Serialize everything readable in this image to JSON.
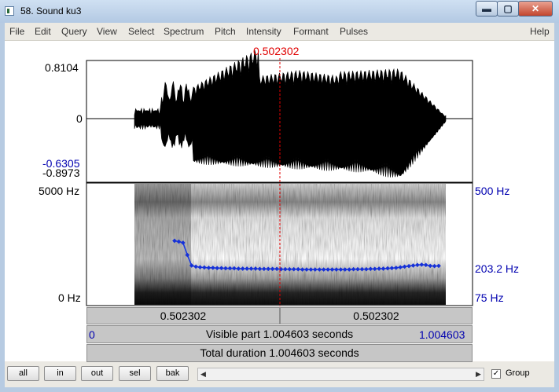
{
  "window": {
    "title": "58. Sound ku3",
    "controls": {
      "minimize": "▬",
      "maximize": "▢",
      "close": "✕"
    }
  },
  "menu": {
    "items": [
      "File",
      "Edit",
      "Query",
      "View",
      "Select",
      "Spectrum",
      "Pitch",
      "Intensity",
      "Formant",
      "Pulses"
    ],
    "help": "Help"
  },
  "cursor": {
    "time": "0.502302"
  },
  "waveform": {
    "max_label": "0.8104",
    "zero_label": "0",
    "sel_min_label": "-0.6305",
    "min_label": "-0.8973"
  },
  "spectrogram": {
    "freq_top": "5000 Hz",
    "freq_bottom": "0 Hz",
    "pitch_top": "500 Hz",
    "pitch_mid": "203.2 Hz",
    "pitch_bottom": "75 Hz"
  },
  "bars": {
    "left_time": "0.502302",
    "right_time": "0.502302",
    "visible_start": "0",
    "visible_text": "Visible part 1.004603 seconds",
    "visible_end": "1.004603",
    "total_text": "Total duration 1.004603 seconds"
  },
  "toolbar": {
    "buttons": [
      "all",
      "in",
      "out",
      "sel",
      "bak"
    ],
    "group_label": "Group",
    "group_checked": "✓"
  },
  "pitch_track": {
    "pitch_hz": [
      300,
      297,
      293,
      250,
      213,
      209,
      207,
      206,
      205,
      205,
      204,
      204,
      203,
      203,
      203,
      202,
      202,
      202,
      202,
      202,
      201,
      201,
      201,
      201,
      201,
      200,
      200,
      200,
      200,
      200,
      199,
      199,
      199,
      199,
      199,
      199,
      199,
      199,
      199,
      199,
      199,
      199,
      200,
      200,
      200,
      200,
      201,
      201,
      202,
      202,
      203,
      204,
      205,
      207,
      209,
      211,
      213,
      215,
      216,
      215,
      212,
      211,
      212
    ]
  },
  "colors": {
    "pitch": "#1530d8",
    "cursor": "#e00000",
    "label_blue": "#0000b0"
  }
}
